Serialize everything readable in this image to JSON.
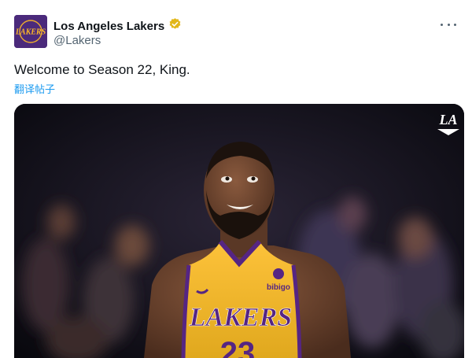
{
  "tweet": {
    "account_name": "Los Angeles Lakers",
    "handle": "@Lakers",
    "verified": true,
    "text": "Welcome to Season 22, King.",
    "translate_label": "翻译帖子",
    "avatar_wordmark": "LAKERS",
    "media": {
      "jersey_wordmark": "LAKERS",
      "jersey_sponsor": "bibigo",
      "jersey_number": "23",
      "watermark": "LA"
    }
  },
  "colors": {
    "text_primary": "#0f1419",
    "text_secondary": "#536471",
    "link": "#1d9bf0",
    "verified_badge": "#e2b719",
    "lakers_purple": "#552583",
    "lakers_gold": "#fdb927"
  },
  "icons": {
    "verified": "verified-badge-icon",
    "more": "more-options-icon"
  }
}
